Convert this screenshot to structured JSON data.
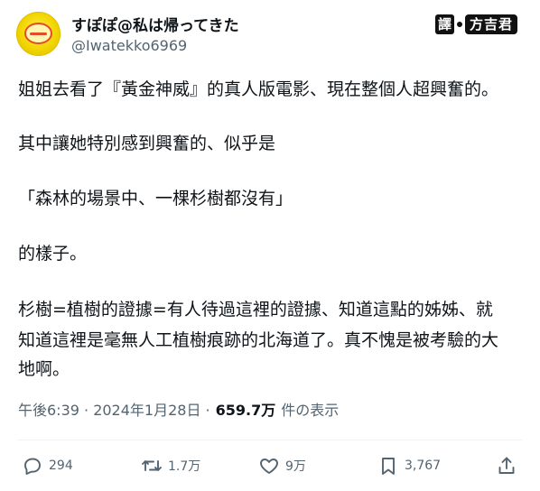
{
  "author": {
    "display_name": "すぽぽ@私は帰ってきた",
    "handle": "@Iwatekko6969",
    "avatar_icon": "avatar-yellow-badge"
  },
  "translator": {
    "prefix": "譯",
    "name": "方吉君"
  },
  "tweet": {
    "lines": [
      "姐姐去看了『黃金神威』的真人版電影、現在整個人超興奮的。",
      "其中讓她特別感到興奮的、似乎是",
      "「森林的場景中、一棵杉樹都沒有」",
      "的樣子。",
      "杉樹=植樹的證據=有人待過這裡的證據、知道這點的姊姊、就",
      "知道這裡是毫無人工植樹痕跡的北海道了。真不愧是被考驗的大",
      "地啊。"
    ]
  },
  "meta": {
    "timestamp": "午後6:39 · 2024年1月28日 ·",
    "views": "659.7万",
    "views_label": "件の表示"
  },
  "actions": {
    "reply_count": "294",
    "retweet_count": "1.7万",
    "like_count": "9万",
    "bookmark_count": "3,767"
  },
  "colors": {
    "text": "#0f1419",
    "secondary": "#536471",
    "divider": "#eff3f4",
    "avatar": "#f2d400"
  }
}
